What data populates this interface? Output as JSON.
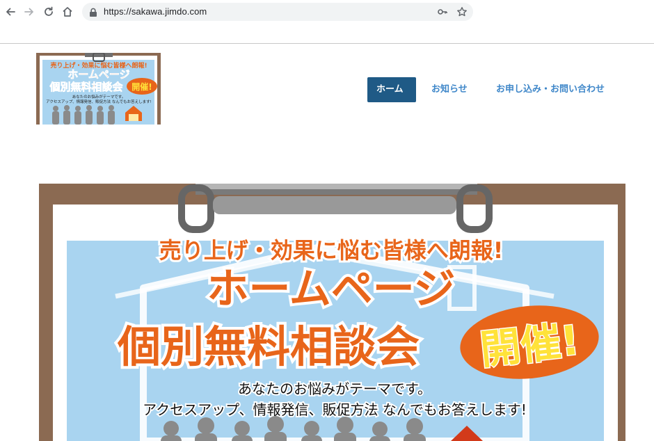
{
  "browser": {
    "url": "https://sakawa.jimdo.com"
  },
  "header": {
    "nav": [
      {
        "label": "ホーム",
        "active": true
      },
      {
        "label": "お知らせ",
        "active": false
      },
      {
        "label": "お申し込み・お問い合わせ",
        "active": false
      }
    ]
  },
  "logo": {
    "line1": "売り上げ・効果に悩む皆様へ朗報!",
    "line2": "ホームページ",
    "line3": "個別無料相談会",
    "badge": "開催!",
    "line4": "あなたのお悩みがテーマです。",
    "line5": "アクセスアップ、情報発信、販促方法 なんでもお答えします!"
  },
  "hero": {
    "line1": "売り上げ・効果に悩む皆様へ朗報!",
    "line2": "ホームページ",
    "line3": "個別無料相談会",
    "badge": "開催!",
    "line4": "あなたのお悩みがテーマです。",
    "line5": "アクセスアップ、情報発信、販促方法 なんでもお答えします!"
  },
  "colors": {
    "nav_active_bg": "#1f5a86",
    "nav_link": "#3f87c9",
    "headline_orange": "#e8651a",
    "sky_blue": "#a9d4f0",
    "clipboard_brown": "#8b6a52",
    "badge_yellow": "#ffe23a"
  }
}
